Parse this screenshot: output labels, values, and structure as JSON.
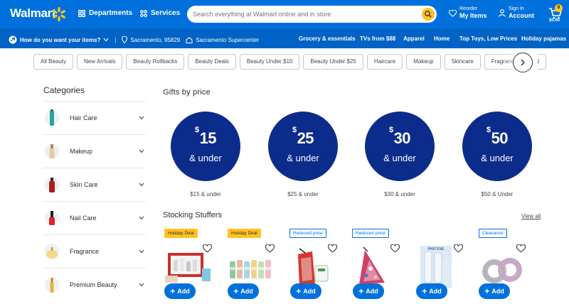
{
  "header": {
    "logo": "Walmart",
    "departments": "Departments",
    "services": "Services",
    "search_placeholder": "Search everything at Walmart online and in store",
    "reorder_top": "Reorder",
    "reorder_main": "My Items",
    "signin_top": "Sign In",
    "signin_main": "Account",
    "cart_count": "0",
    "cart_total": "$0.00"
  },
  "subnav": {
    "delivery": "How do you want your items?",
    "location": "Sacramento, 95829",
    "store": "Sacramento Supercenter",
    "links": [
      "Grocery & essentials",
      "TVs from $88",
      "Apparel",
      "Home",
      "Top Toys, Low Prices",
      "Holiday pajamas"
    ]
  },
  "pills": [
    "All Beauty",
    "New Arrivals",
    "Beauty Rollbacks",
    "Beauty Deals",
    "Beauty Under $10",
    "Beauty Under $25",
    "Haircare",
    "Makeup",
    "Skincare",
    "Fragrance",
    "N"
  ],
  "categories": {
    "title": "Categories",
    "items": [
      "Hair Care",
      "Makeup",
      "Skin Care",
      "Nail Care",
      "Fragrance",
      "Premium Beauty"
    ]
  },
  "gifts": {
    "title": "Gifts by price",
    "items": [
      {
        "amount": "15",
        "under": "& under",
        "caption": "$15 & under"
      },
      {
        "amount": "25",
        "under": "& under",
        "caption": "$25 & under"
      },
      {
        "amount": "30",
        "under": "& under",
        "caption": "$30 & under"
      },
      {
        "amount": "50",
        "under": "& under",
        "caption": "$50 & Under"
      }
    ]
  },
  "stocking": {
    "title": "Stocking Stuffers",
    "view_all": "View all",
    "tags": [
      "Holiday Deal",
      "Holiday Deal",
      "Reduced price",
      "Reduced price",
      "",
      "Clearance"
    ],
    "add_label": "Add"
  },
  "colors": {
    "brand_blue": "#0071dc",
    "spark_yellow": "#ffc220",
    "gift_navy": "#0c2c8c"
  }
}
